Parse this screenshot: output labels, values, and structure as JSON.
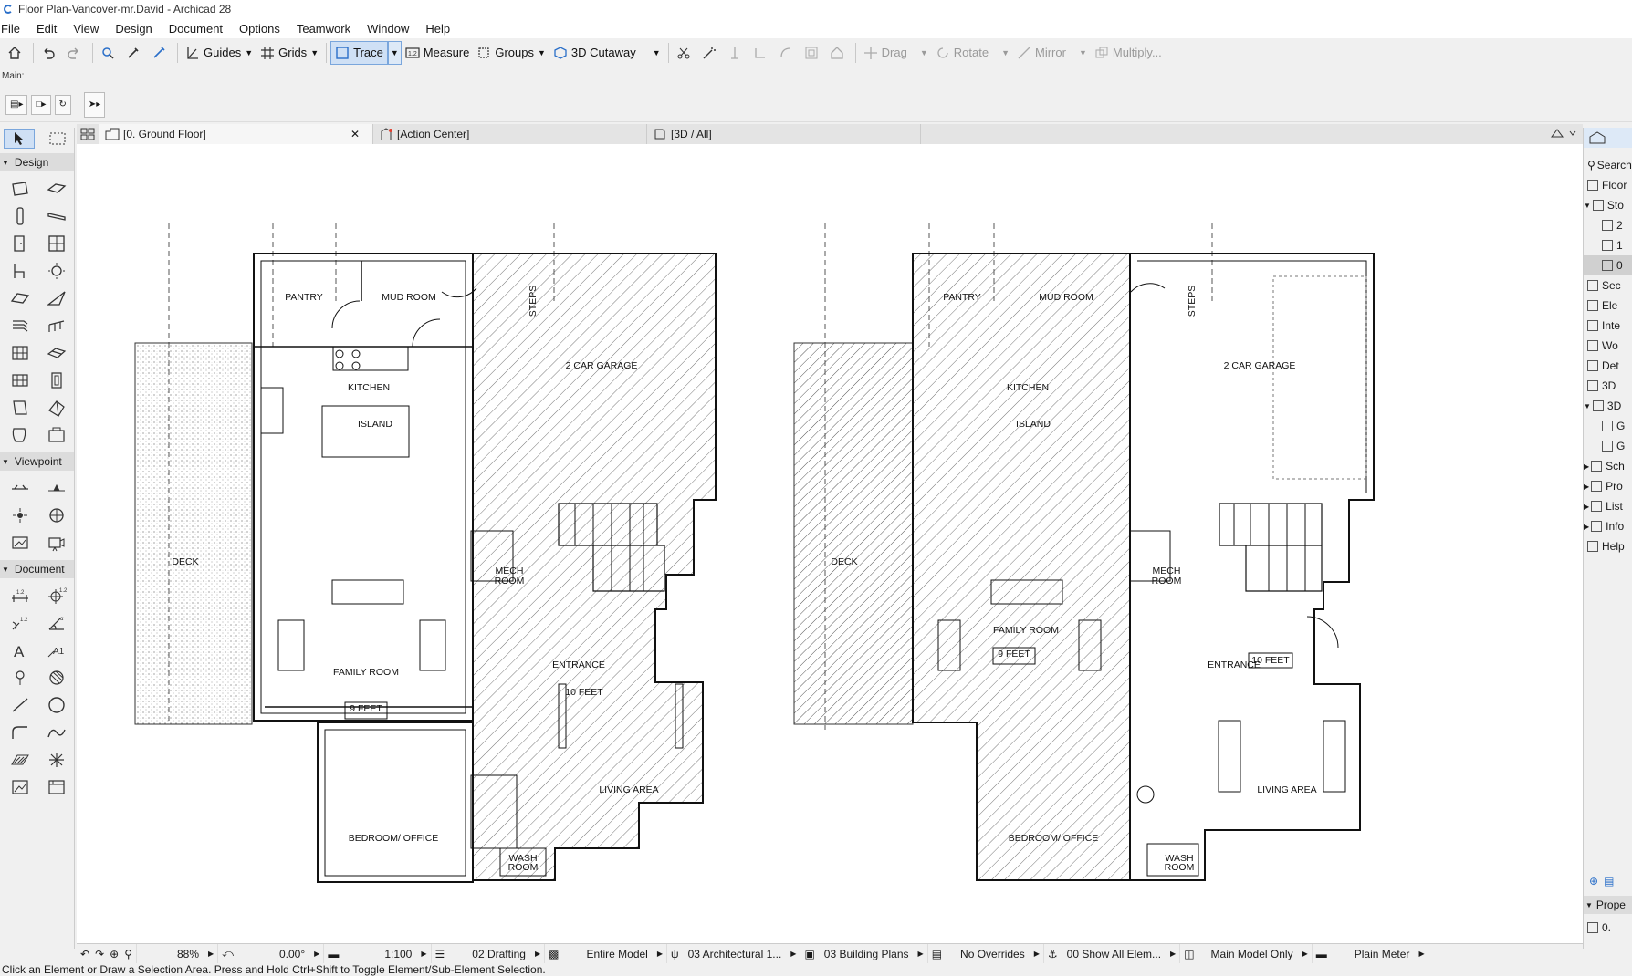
{
  "window": {
    "title": "Floor Plan-Vancover-mr.David - Archicad 28"
  },
  "menu": [
    "File",
    "Edit",
    "View",
    "Design",
    "Document",
    "Options",
    "Teamwork",
    "Window",
    "Help"
  ],
  "toolbar": {
    "guides": "Guides",
    "grids": "Grids",
    "trace": "Trace",
    "measure": "Measure",
    "groups": "Groups",
    "cutaway": "3D Cutaway",
    "drag": "Drag",
    "rotate": "Rotate",
    "mirror": "Mirror",
    "multiply": "Multiply..."
  },
  "infobox": {
    "label": "Main:"
  },
  "tabs": {
    "floor": "[0. Ground Floor]",
    "action": "[Action Center]",
    "view3d": "[3D / All]"
  },
  "toolbox": {
    "design": "Design",
    "viewpoint": "Viewpoint",
    "document": "Document"
  },
  "plan": {
    "pantry": "PANTRY",
    "mud_room": "MUD ROOM",
    "steps": "STEPS",
    "garage": "2 CAR GARAGE",
    "kitchen": "KITCHEN",
    "island": "ISLAND",
    "deck": "DECK",
    "mech1": "MECH",
    "mech2": "ROOM",
    "family": "FAMILY ROOM",
    "entrance": "ENTRANCE",
    "ten_feet": "10 FEET",
    "nine_feet": "9 FEET",
    "living": "LIVING  AREA",
    "bedroom": "BEDROOM/     OFFICE",
    "wash1": "WASH",
    "wash2": "ROOM"
  },
  "navigator": {
    "search": "Search",
    "items": [
      "Floor",
      "Sto",
      "2",
      "1",
      "0",
      "Sec",
      "Ele",
      "Inte",
      "Wo",
      "Det",
      "3D",
      "3D",
      "G",
      "G",
      "Sch",
      "Pro",
      "List",
      "Info",
      "Help"
    ],
    "properties": "Prope",
    "prop_val": "0."
  },
  "status": {
    "zoom": "88%",
    "angle": "0.00°",
    "scale": "1:100",
    "layer": "02 Drafting",
    "model": "Entire Model",
    "pen": "03 Architectural 1...",
    "mvo": "03 Building Plans",
    "override": "No Overrides",
    "renovation": "00 Show All Elem...",
    "structure": "Main Model Only",
    "dimension": "Plain Meter"
  },
  "hint": "Click an Element or Draw a Selection Area. Press and Hold Ctrl+Shift to Toggle Element/Sub-Element Selection."
}
